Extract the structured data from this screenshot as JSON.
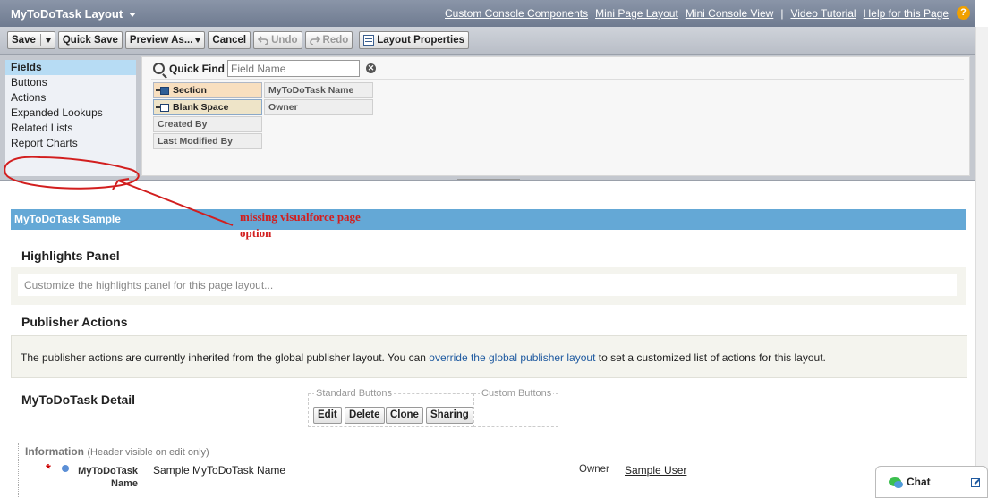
{
  "header": {
    "title": "MyToDoTask Layout",
    "links": [
      "Custom Console Components",
      "Mini Page Layout",
      "Mini Console View",
      "Video Tutorial",
      "Help for this Page"
    ],
    "help_glyph": "?"
  },
  "toolbar": {
    "save": "Save",
    "quick_save": "Quick Save",
    "preview_as": "Preview As...",
    "cancel": "Cancel",
    "undo": "Undo",
    "redo": "Redo",
    "layout_properties": "Layout Properties"
  },
  "palette": {
    "categories": [
      "Fields",
      "Buttons",
      "Actions",
      "Expanded Lookups",
      "Related Lists",
      "Report Charts"
    ],
    "selected": "Fields",
    "quick_find_label": "Quick Find",
    "quick_find_placeholder": "Field Name",
    "fields": [
      "Section",
      "Blank Space",
      "Created By",
      "Last Modified By",
      "MyToDoTask Name",
      "Owner"
    ]
  },
  "annotation": {
    "text": "missing visualforce page option",
    "color": "#d21e1e"
  },
  "layout": {
    "sample_bar": "MyToDoTask Sample",
    "highlights_title": "Highlights Panel",
    "highlights_placeholder": "Customize the highlights panel for this page layout...",
    "publisher_title": "Publisher Actions",
    "publisher_text_before": "The publisher actions are currently inherited from the global publisher layout. You can ",
    "publisher_link": "override the global publisher layout",
    "publisher_text_after": " to set a customized list of actions for this layout.",
    "detail_title": "MyToDoTask Detail",
    "standard_buttons_label": "Standard Buttons",
    "custom_buttons_label": "Custom Buttons",
    "standard_buttons": [
      "Edit",
      "Delete",
      "Clone",
      "Sharing"
    ],
    "info_header": "Information",
    "info_header_sub": "(Header visible on edit only)",
    "required_mark": "*",
    "field_label": "MyToDoTask Name",
    "field_value": "Sample MyToDoTask Name",
    "owner_label": "Owner",
    "owner_value": "Sample User"
  },
  "chat": {
    "label": "Chat"
  },
  "colors": {
    "title_bar": "#7b869a",
    "sample_bar": "#64a8d6",
    "link": "#1f5aa0",
    "selected": "#b7dcf4"
  }
}
